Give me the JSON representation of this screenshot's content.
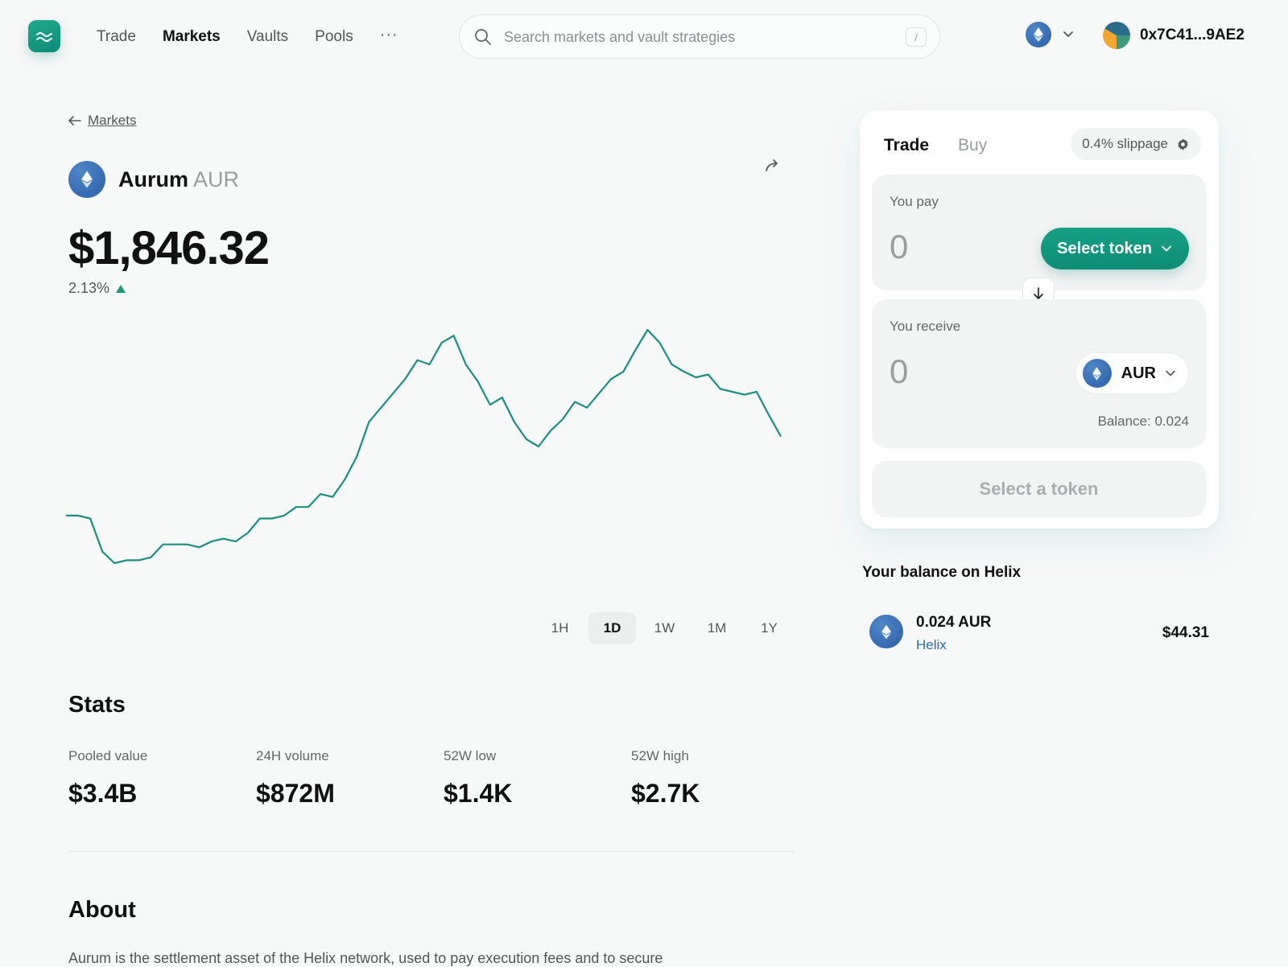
{
  "nav": {
    "items": [
      {
        "label": "Trade",
        "active": false
      },
      {
        "label": "Markets",
        "active": true
      },
      {
        "label": "Vaults",
        "active": false
      },
      {
        "label": "Pools",
        "active": false
      }
    ],
    "more_label": "···"
  },
  "search": {
    "placeholder": "Search markets and vault strategies",
    "shortcut": "/"
  },
  "network": {
    "icon": "eth-icon"
  },
  "wallet": {
    "address": "0x7C41...9AE2"
  },
  "breadcrumb": {
    "back_label": "Markets"
  },
  "asset": {
    "name": "Aurum",
    "symbol": "AUR",
    "price": "$1,846.32",
    "change": "2.13%",
    "change_direction": "up"
  },
  "chart_data": {
    "type": "line",
    "color": "#17907d",
    "values": [
      1185,
      1185,
      1183,
      1160,
      1152,
      1154,
      1154,
      1156,
      1165,
      1165,
      1165,
      1163,
      1167,
      1169,
      1167,
      1173,
      1183,
      1183,
      1185,
      1191,
      1191,
      1200,
      1198,
      1210,
      1226,
      1250,
      1260,
      1270,
      1280,
      1293,
      1290,
      1305,
      1310,
      1290,
      1278,
      1262,
      1267,
      1250,
      1238,
      1233,
      1244,
      1252,
      1264,
      1260,
      1270,
      1280,
      1285,
      1300,
      1314,
      1305,
      1290,
      1285,
      1281,
      1283,
      1273,
      1271,
      1269,
      1271,
      1255,
      1240
    ],
    "selected_range": "1D"
  },
  "ranges": [
    "1H",
    "1D",
    "1W",
    "1M",
    "1Y"
  ],
  "stats": {
    "title": "Stats",
    "items": [
      {
        "label": "Pooled value",
        "value": "$3.4B"
      },
      {
        "label": "24H volume",
        "value": "$872M"
      },
      {
        "label": "52W low",
        "value": "$1.4K"
      },
      {
        "label": "52W high",
        "value": "$2.7K"
      }
    ]
  },
  "about": {
    "title": "About",
    "text": "Aurum is the settlement asset of the Helix network, used to pay execution fees and to secure"
  },
  "trade": {
    "tab_trade": "Trade",
    "tab_buy": "Buy",
    "slippage": "0.4% slippage",
    "pay_label": "You pay",
    "pay_amount": "0",
    "select_token": "Select token",
    "receive_label": "You receive",
    "receive_amount": "0",
    "receive_token": "AUR",
    "balance": "Balance: 0.024",
    "cta": "Select a token"
  },
  "your_balance": {
    "title": "Your balance on Helix",
    "amount": "0.024 AUR",
    "network": "Helix",
    "usd": "$44.31"
  }
}
